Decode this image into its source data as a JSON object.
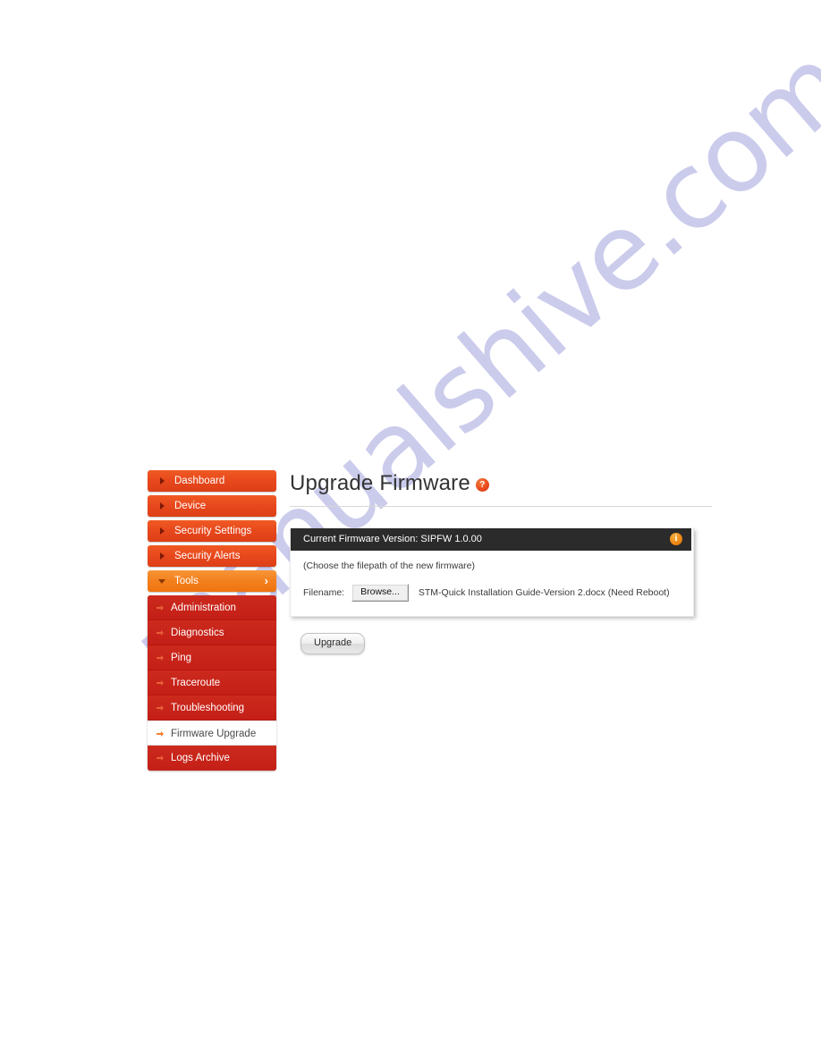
{
  "watermark": {
    "text": "manualshive.com",
    "color": "#c9c9ec"
  },
  "sidebar": {
    "main_items": [
      {
        "label": "Dashboard",
        "bullet": "triangle-right-icon",
        "active": false
      },
      {
        "label": "Device",
        "bullet": "triangle-right-icon",
        "active": false
      },
      {
        "label": "Security Settings",
        "bullet": "triangle-right-icon",
        "active": false
      },
      {
        "label": "Security Alerts",
        "bullet": "triangle-right-icon",
        "active": false
      },
      {
        "label": "Tools",
        "bullet": "triangle-down-icon",
        "active": true,
        "chevron": "›"
      }
    ],
    "sub_items": [
      {
        "label": "Administration",
        "selected": false
      },
      {
        "label": "Diagnostics",
        "selected": false
      },
      {
        "label": "Ping",
        "selected": false
      },
      {
        "label": "Traceroute",
        "selected": false
      },
      {
        "label": "Troubleshooting",
        "selected": false
      },
      {
        "label": "Firmware Upgrade",
        "selected": true
      },
      {
        "label": "Logs Archive",
        "selected": false
      }
    ],
    "colors": {
      "main_bg": "#e8481c",
      "main_active_bg": "#f3811f",
      "sub_bg": "#c41f17",
      "selected_bg": "#ffffff"
    }
  },
  "content": {
    "title": "Upgrade Firmware",
    "help_icon": "?",
    "panel": {
      "header_text": "Current Firmware Version: SIPFW 1.0.00",
      "info_icon": "i",
      "hint": "(Choose the filepath of the new firmware)",
      "filename_label": "Filename:",
      "browse_label": "Browse...",
      "filename_value": "STM-Quick Installation Guide-Version 2.docx (Need Reboot)"
    },
    "upgrade_label": "Upgrade"
  }
}
